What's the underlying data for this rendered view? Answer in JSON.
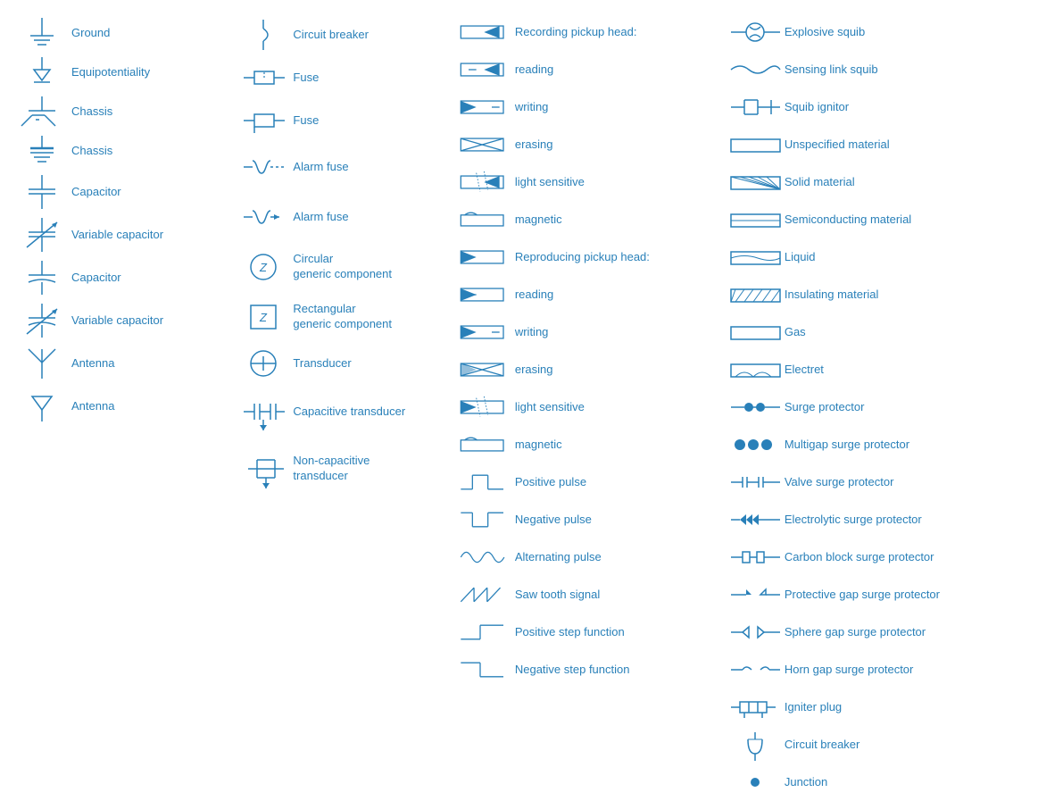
{
  "col1": [
    {
      "symbol": "ground",
      "label": "Ground"
    },
    {
      "symbol": "equipotentiality",
      "label": "Equipotentiality"
    },
    {
      "symbol": "chassis1",
      "label": "Chassis"
    },
    {
      "symbol": "chassis2",
      "label": "Chassis"
    },
    {
      "symbol": "capacitor1",
      "label": "Capacitor"
    },
    {
      "symbol": "variable-capacitor1",
      "label": "Variable capacitor"
    },
    {
      "symbol": "capacitor2",
      "label": "Capacitor"
    },
    {
      "symbol": "variable-capacitor2",
      "label": "Variable capacitor"
    },
    {
      "symbol": "antenna1",
      "label": "Antenna"
    },
    {
      "symbol": "antenna2",
      "label": "Antenna"
    }
  ],
  "col2": [
    {
      "symbol": "circuit-breaker",
      "label": "Circuit breaker"
    },
    {
      "symbol": "fuse1",
      "label": "Fuse"
    },
    {
      "symbol": "fuse2",
      "label": "Fuse"
    },
    {
      "symbol": "alarm-fuse1",
      "label": "Alarm fuse"
    },
    {
      "symbol": "alarm-fuse2",
      "label": "Alarm fuse"
    },
    {
      "symbol": "circular-generic",
      "label": "Circular\ngeneric component"
    },
    {
      "symbol": "rectangular-generic",
      "label": "Rectangular\ngeneric component"
    },
    {
      "symbol": "transducer",
      "label": "Transducer"
    },
    {
      "symbol": "capacitive-transducer",
      "label": "Capacitive transducer"
    },
    {
      "symbol": "non-capacitive-transducer",
      "label": "Non-capacitive\ntransducer"
    }
  ],
  "col3": [
    {
      "symbol": "recording-pickup-head",
      "label": "Recording pickup head:"
    },
    {
      "symbol": "reading1",
      "label": "reading"
    },
    {
      "symbol": "writing1",
      "label": "writing"
    },
    {
      "symbol": "erasing1",
      "label": "erasing"
    },
    {
      "symbol": "light-sensitive1",
      "label": "light sensitive"
    },
    {
      "symbol": "magnetic1",
      "label": "magnetic"
    },
    {
      "symbol": "reproducing-pickup-head",
      "label": "Reproducing pickup head:"
    },
    {
      "symbol": "reading2",
      "label": "reading"
    },
    {
      "symbol": "writing2",
      "label": "writing"
    },
    {
      "symbol": "erasing2",
      "label": "erasing"
    },
    {
      "symbol": "light-sensitive2",
      "label": "light sensitive"
    },
    {
      "symbol": "magnetic2",
      "label": "magnetic"
    },
    {
      "symbol": "positive-pulse",
      "label": "Positive pulse"
    },
    {
      "symbol": "negative-pulse",
      "label": "Negative pulse"
    },
    {
      "symbol": "alternating-pulse",
      "label": "Alternating pulse"
    },
    {
      "symbol": "saw-tooth",
      "label": "Saw tooth signal"
    },
    {
      "symbol": "positive-step",
      "label": "Positive step function"
    },
    {
      "symbol": "negative-step",
      "label": "Negative step function"
    }
  ],
  "col4": [
    {
      "symbol": "explosive-squib",
      "label": "Explosive squib"
    },
    {
      "symbol": "sensing-link-squib",
      "label": "Sensing link squib"
    },
    {
      "symbol": "squib-ignitor",
      "label": "Squib ignitor"
    },
    {
      "symbol": "unspecified-material",
      "label": "Unspecified material"
    },
    {
      "symbol": "solid-material",
      "label": "Solid material"
    },
    {
      "symbol": "semiconducting-material",
      "label": "Semiconducting material"
    },
    {
      "symbol": "liquid",
      "label": "Liquid"
    },
    {
      "symbol": "insulating-material",
      "label": "Insulating material"
    },
    {
      "symbol": "gas",
      "label": "Gas"
    },
    {
      "symbol": "electret",
      "label": "Electret"
    },
    {
      "symbol": "surge-protector",
      "label": "Surge protector"
    },
    {
      "symbol": "multigap-surge-protector",
      "label": "Multigap surge protector"
    },
    {
      "symbol": "valve-surge-protector",
      "label": "Valve surge protector"
    },
    {
      "symbol": "electrolytic-surge-protector",
      "label": "Electrolytic surge protector"
    },
    {
      "symbol": "carbon-block-surge-protector",
      "label": "Carbon block surge protector"
    },
    {
      "symbol": "protective-gap-surge-protector",
      "label": "Protective gap surge protector"
    },
    {
      "symbol": "sphere-gap-surge-protector",
      "label": "Sphere gap surge protector"
    },
    {
      "symbol": "horn-gap-surge-protector",
      "label": "Horn gap surge protector"
    },
    {
      "symbol": "igniter-plug",
      "label": "Igniter plug"
    },
    {
      "symbol": "circuit-breaker2",
      "label": "Circuit breaker"
    },
    {
      "symbol": "junction",
      "label": "Junction"
    }
  ]
}
